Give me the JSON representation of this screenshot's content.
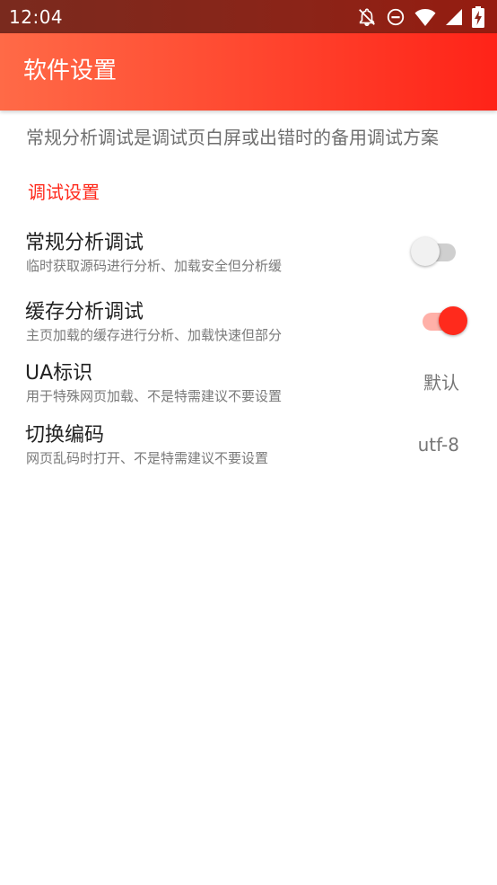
{
  "status_bar": {
    "time": "12:04",
    "icons": [
      "notifications-off-icon",
      "do-not-disturb-icon",
      "wifi-icon",
      "signal-icon",
      "battery-charging-icon"
    ]
  },
  "app_bar": {
    "title": "软件设置"
  },
  "description": "常规分析调试是调试页白屏或出错时的备用调试方案",
  "category": {
    "title": "调试设置"
  },
  "preferences": [
    {
      "title": "常规分析调试",
      "summary": "临时获取源码进行分析、加载安全但分析缓",
      "type": "switch",
      "checked": false
    },
    {
      "title": "缓存分析调试",
      "summary": "主页加载的缓存进行分析、加载快速但部分",
      "type": "switch",
      "checked": true
    },
    {
      "title": "UA标识",
      "summary": "用于特殊网页加载、不是特需建议不要设置",
      "type": "value",
      "value": "默认"
    },
    {
      "title": "切换编码",
      "summary": "网页乱码时打开、不是特需建议不要设置",
      "type": "value",
      "value": "utf-8"
    }
  ],
  "colors": {
    "accent": "#ff2a1c",
    "app_bar_start": "#ff6a47",
    "app_bar_end": "#ff2318",
    "status_bar": "#8b2418"
  }
}
